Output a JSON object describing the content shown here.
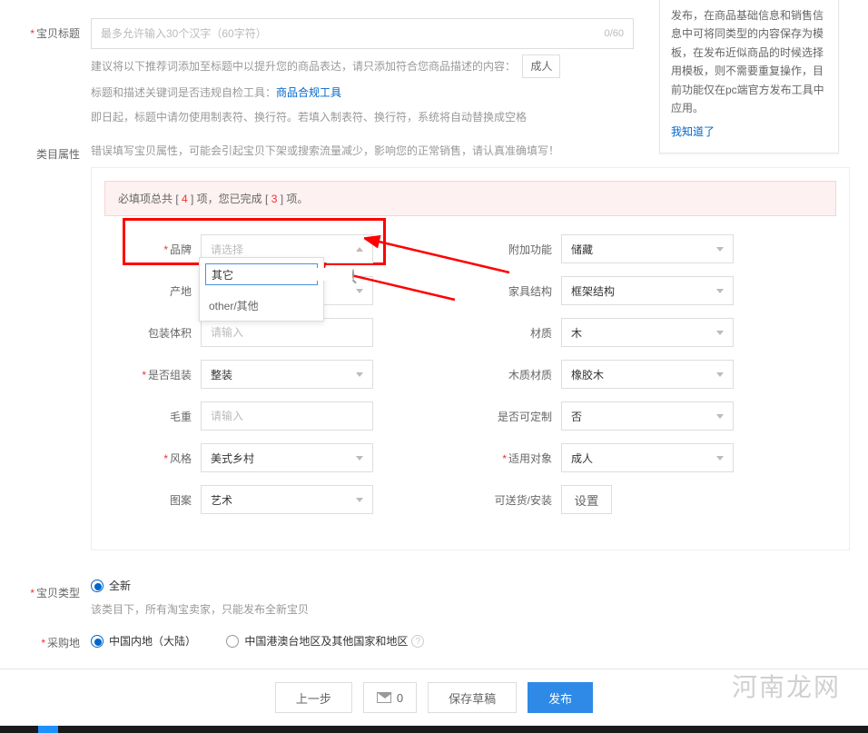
{
  "title_row": {
    "label": "宝贝标题",
    "placeholder": "最多允许输入30个汉字（60字符）",
    "counter": "0/60",
    "hint_prefix": "建议将以下推荐词添加至标题中以提升您的商品表达，请只添加符合您商品描述的内容：",
    "hint_tag": "成人",
    "hint_line2_a": "标题和描述关键词是否违规自检工具：",
    "hint_line2_link": "商品合规工具",
    "hint_line3": "即日起，标题中请勿使用制表符、换行符。若填入制表符、换行符，系统将自动替换成空格"
  },
  "category_attrs": {
    "label": "类目属性",
    "warn": "错误填写宝贝属性，可能会引起宝贝下架或搜索流量减少，影响您的正常销售，请认真准确填写！",
    "required_bar_a": "必填项总共 [",
    "required_bar_total": " 4 ",
    "required_bar_b": "] 项，您已完成 [",
    "required_bar_done": " 3 ",
    "required_bar_c": "] 项。"
  },
  "attrs_left": {
    "brand": {
      "label": "品牌",
      "value": "请选择"
    },
    "origin": {
      "label": "产地"
    },
    "pack_vol": {
      "label": "包装体积",
      "placeholder": "请输入"
    },
    "assembly": {
      "label": "是否组装",
      "value": "整装"
    },
    "weight": {
      "label": "毛重",
      "placeholder": "请输入"
    },
    "style": {
      "label": "风格",
      "value": "美式乡村"
    },
    "pattern": {
      "label": "图案",
      "value": "艺术"
    }
  },
  "attrs_right": {
    "addon": {
      "label": "附加功能",
      "value": "储藏"
    },
    "structure": {
      "label": "家具结构",
      "value": "框架结构"
    },
    "material": {
      "label": "材质",
      "value": "木"
    },
    "wood": {
      "label": "木质材质",
      "value": "橡胶木"
    },
    "custom": {
      "label": "是否可定制",
      "value": "否"
    },
    "target": {
      "label": "适用对象",
      "value": "成人"
    },
    "delivery": {
      "label": "可送货/安装",
      "button": "设置"
    }
  },
  "dropdown": {
    "search_value": "其它",
    "option1": "other/其他"
  },
  "info_panel": {
    "text": "发布，在商品基础信息和销售信息中可将同类型的内容保存为模板，在发布近似商品的时候选择用模板，则不需要重复操作，目前功能仅在pc端官方发布工具中应用。",
    "know": "我知道了"
  },
  "type_section": {
    "label": "宝贝类型",
    "opt_new": "全新",
    "hint": "该类目下，所有淘宝卖家，只能发布全新宝贝"
  },
  "purchase_section": {
    "label": "采购地",
    "opt_mainland": "中国内地（大陆）",
    "opt_overseas": "中国港澳台地区及其他国家和地区"
  },
  "bottom_bar": {
    "prev": "上一步",
    "msg_count": "0",
    "save_draft": "保存草稿",
    "publish": "发布"
  },
  "watermark": "河南龙网"
}
